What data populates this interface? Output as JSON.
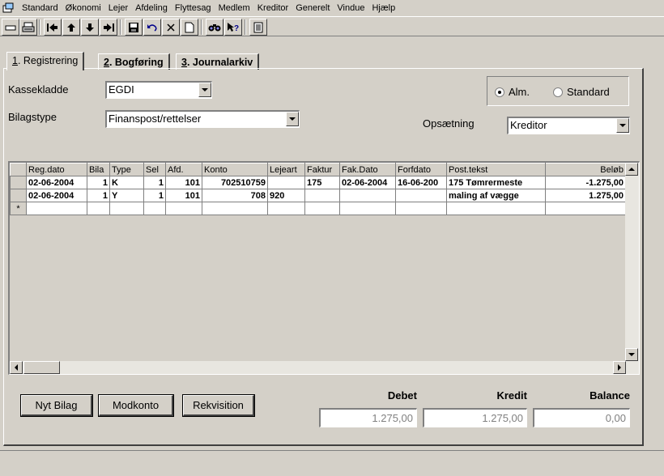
{
  "menu": [
    "Standard",
    "Økonomi",
    "Lejer",
    "Afdeling",
    "Flyttesag",
    "Medlem",
    "Kreditor",
    "Generelt",
    "Vindue",
    "Hjælp"
  ],
  "toolbar": {
    "icons": [
      "window-icon",
      "print-icon",
      "first-record-icon",
      "prev-record-icon",
      "next-record-icon",
      "last-record-icon",
      "save-icon",
      "undo-icon",
      "delete-icon",
      "new-document-icon",
      "find-icon",
      "help-pointer-icon",
      "report-icon"
    ]
  },
  "tabs": [
    {
      "num": "1",
      "label": ". Registrering"
    },
    {
      "num": "2",
      "label": ". Bogføring"
    },
    {
      "num": "3",
      "label": ". Journalarkiv"
    }
  ],
  "form": {
    "kassekladde_label": "Kassekladde",
    "kassekladde_value": "EGDI",
    "bilagstype_label": "Bilagstype",
    "bilagstype_value": "Finanspost/rettelser",
    "opsaetning_label": "Opsætning",
    "opsaetning_value": "Kreditor",
    "radio_alm": "Alm.",
    "radio_standard": "Standard",
    "radio_selected": "alm"
  },
  "grid": {
    "columns": [
      "Reg.dato",
      "Bila",
      "Type",
      "Sel",
      "Afd.",
      "Konto",
      "Lejeart",
      "Faktur",
      "Fak.Dato",
      "Forfdato",
      "Post.tekst",
      "Beløb"
    ],
    "rows": [
      [
        "02-06-2004",
        "1",
        "K",
        "1",
        "101",
        "702510759",
        "",
        "175",
        "02-06-2004",
        "16-06-200",
        "175  Tømrermeste",
        "-1.275,00"
      ],
      [
        "02-06-2004",
        "1",
        "Y",
        "1",
        "101",
        "708",
        "920",
        "",
        "",
        "",
        "maling af vægge",
        "1.275,00"
      ]
    ],
    "new_row_marker": "*"
  },
  "buttons": {
    "nyt_bilag": "Nyt Bilag",
    "modkonto": "Modkonto",
    "rekvisition": "Rekvisition"
  },
  "totals": {
    "debet_label": "Debet",
    "kredit_label": "Kredit",
    "balance_label": "Balance",
    "debet": "1.275,00",
    "kredit": "1.275,00",
    "balance": "0,00"
  }
}
